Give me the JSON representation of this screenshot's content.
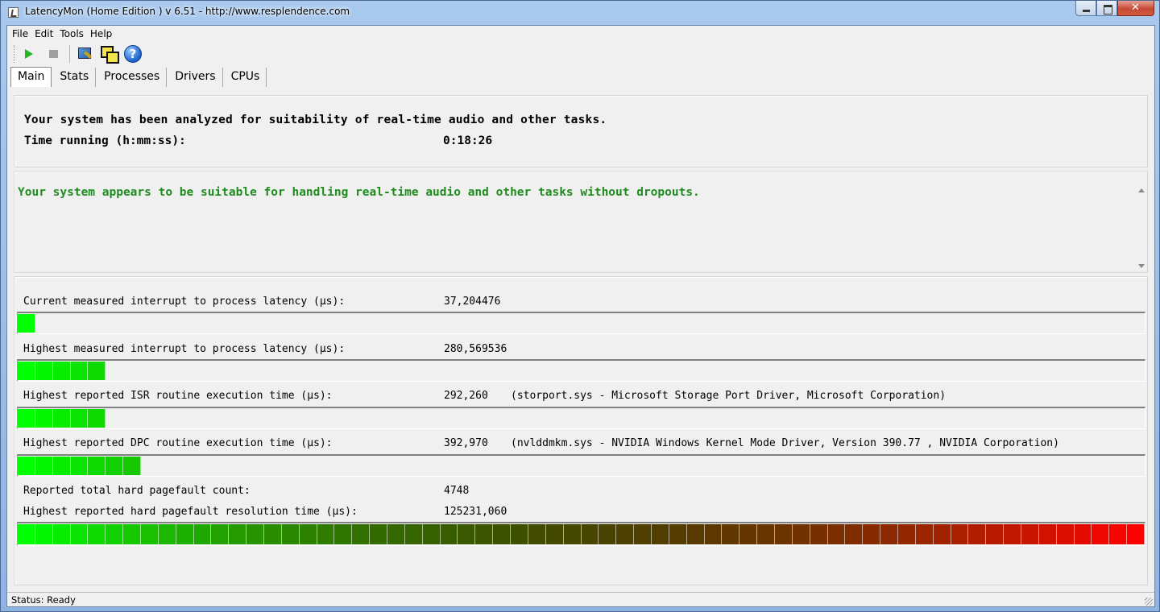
{
  "window": {
    "title": "LatencyMon  (Home Edition )  v 6.51 - http://www.resplendence.com"
  },
  "menu": [
    "File",
    "Edit",
    "Tools",
    "Help"
  ],
  "toolbar": {
    "icons": [
      "play-icon",
      "stop-icon",
      "tool-icon",
      "windows-icon",
      "help-icon"
    ],
    "help_glyph": "?"
  },
  "tabs": [
    "Main",
    "Stats",
    "Processes",
    "Drivers",
    "CPUs"
  ],
  "active_tab": "Main",
  "summary": {
    "analyzed_line": "Your system has been analyzed for suitability of real-time audio and other tasks.",
    "time_label": "Time running (h:mm:ss):",
    "time_value": "0:18:26"
  },
  "verdict": {
    "text": "Your system appears to be suitable for handling real-time audio and other tasks without dropouts.",
    "color": "#1e8c1e"
  },
  "measurements": [
    {
      "label": "Current measured interrupt to process latency (µs):",
      "value": "37,204476",
      "detail": "",
      "meter_segments": 1
    },
    {
      "label": "Highest measured interrupt to process latency (µs):",
      "value": "280,569536",
      "detail": "",
      "meter_segments": 5
    },
    {
      "label": "Highest reported ISR routine execution time (µs):",
      "value": "292,260",
      "detail": "(storport.sys - Microsoft Storage Port Driver, Microsoft Corporation)",
      "meter_segments": 5
    },
    {
      "label": "Highest reported DPC routine execution time (µs):",
      "value": "392,970",
      "detail": "(nvlddmkm.sys - NVIDIA Windows Kernel Mode Driver, Version 390.77 , NVIDIA Corporation)",
      "meter_segments": 7
    }
  ],
  "pagefaults": {
    "count_label": "Reported total hard pagefault count:",
    "count_value": "4748",
    "resolution_label": "Highest reported hard pagefault resolution time (µs):",
    "resolution_value": "125231,060",
    "meter_segments": 64
  },
  "meter": {
    "total_segments": 64,
    "start_color": "#00ff00",
    "end_color": "#ff0000"
  },
  "status": {
    "text": "Status: Ready"
  }
}
